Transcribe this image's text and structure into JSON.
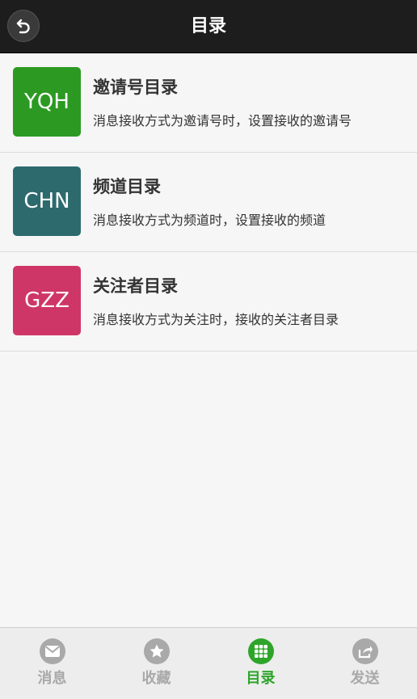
{
  "header": {
    "title": "目录"
  },
  "colors": {
    "header_bg": "#1d1d1d",
    "active_tab": "#2ea52a",
    "inactive_tab": "#a9a9a9"
  },
  "list": {
    "items": [
      {
        "badge": "YQH",
        "title": "邀请号目录",
        "desc": "消息接收方式为邀请号时，设置接收的邀请号",
        "color": "#2c9a22"
      },
      {
        "badge": "CHN",
        "title": "频道目录",
        "desc": "消息接收方式为频道时，设置接收的频道",
        "color": "#2d6a6e"
      },
      {
        "badge": "GZZ",
        "title": "关注者目录",
        "desc": "消息接收方式为关注时，接收的关注者目录",
        "color": "#cf3668"
      }
    ]
  },
  "tabbar": {
    "tabs": [
      {
        "label": "消息",
        "icon": "envelope-icon",
        "active": false
      },
      {
        "label": "收藏",
        "icon": "star-icon",
        "active": false
      },
      {
        "label": "目录",
        "icon": "grid-icon",
        "active": true
      },
      {
        "label": "发送",
        "icon": "share-icon",
        "active": false
      }
    ]
  }
}
